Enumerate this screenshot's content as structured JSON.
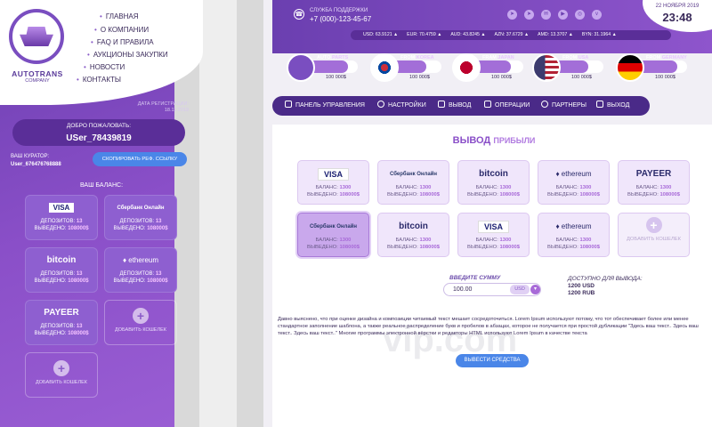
{
  "brand": {
    "name": "AUTOTRANS",
    "sub": "COMPANY"
  },
  "menu": [
    "ГЛАВНАЯ",
    "О КОМПАНИИ",
    "FAQ И ПРАВИЛА",
    "АУКЦИОНЫ ЗАКУПКИ",
    "НОВОСТИ",
    "КОНТАКТЫ"
  ],
  "reg": {
    "label": "ДАТА РЕГИСТРАЦИИ:",
    "date": "18.11.2019"
  },
  "welcome": {
    "label": "ДОБРО ПОЖАЛОВАТЬ:",
    "user": "USer_78439819"
  },
  "curator": {
    "label": "ВАШ КУРАТОР:",
    "name": "User_676476768888"
  },
  "copy_btn": "СКОПИРОВАТЬ РЕФ. ССЫЛКУ",
  "balance_title": "ВАШ БАЛАНС:",
  "left_cards": [
    {
      "logo": "VISA",
      "dep_l": "ДЕПОЗИТОВ:",
      "dep": "13",
      "out_l": "ВЫВЕДЕНО:",
      "out": "108000$"
    },
    {
      "logo": "Сбербанк Онлайн",
      "dep_l": "ДЕПОЗИТОВ:",
      "dep": "13",
      "out_l": "ВЫВЕДЕНО:",
      "out": "108000$"
    },
    {
      "logo": "bitcoin",
      "dep_l": "ДЕПОЗИТОВ:",
      "dep": "13",
      "out_l": "ВЫВЕДЕНО:",
      "out": "108000$"
    },
    {
      "logo": "ethereum",
      "dep_l": "ДЕПОЗИТОВ:",
      "dep": "13",
      "out_l": "ВЫВЕДЕНО:",
      "out": "108000$"
    },
    {
      "logo": "PAYEER",
      "dep_l": "ДЕПОЗИТОВ:",
      "dep": "13",
      "out_l": "ВЫВЕДЕНО:",
      "out": "108000$"
    }
  ],
  "add_wallet": "ДОБАВИТЬ КОШЕЛЕК",
  "support": {
    "label": "СЛУЖБА ПОДДЕРЖКИ",
    "phone": "+7 (000)-123-45-67"
  },
  "date": "22 НОЯБРЯ 2019",
  "time": "23:48",
  "rates": [
    "USD: 63.9121 ▲",
    "EUR: 70.4759 ▲",
    "AUD: 43.8245 ▲",
    "AZN: 37.6729 ▲",
    "AMD: 13.3707 ▲",
    "BYN: 31.1964 ▲"
  ],
  "progress": [
    {
      "k": "AUTO",
      "s": "PARTS",
      "amount": "100 000$",
      "color": "#7a4ec0",
      "pct": 0.8
    },
    {
      "k": "FROM",
      "s": "KOREA",
      "amount": "100 000$",
      "color": "#ffffff",
      "pct": 0.7
    },
    {
      "k": "FRAM",
      "s": "JAPAN",
      "amount": "100 000$",
      "color": "#ffffff",
      "pct": 0.75
    },
    {
      "k": "FROM",
      "s": "USA",
      "amount": "100 000$",
      "color": "#3c3b6e",
      "pct": 0.7
    },
    {
      "k": "FROM",
      "s": "GERMANY",
      "amount": "100 000$",
      "color": "#000000",
      "pct": 0.8
    }
  ],
  "nav": [
    "ПАНЕЛЬ УПРАВЛЕНИЯ",
    "НАСТРОЙКИ",
    "ВЫВОД",
    "ОПЕРАЦИИ",
    "ПАРТНЕРЫ",
    "ВЫХОД"
  ],
  "page_title": "ВЫВОД",
  "page_title2": "ПРИБЫЛИ",
  "wcards": [
    {
      "logo": "VISA",
      "bl": "БАЛАНС:",
      "b": "1300",
      "ol": "ВЫВЕДЕНО:",
      "o": "108000$"
    },
    {
      "logo": "Сбербанк Онлайн",
      "bl": "БАЛАНС:",
      "b": "1300",
      "ol": "ВЫВЕДЕНО:",
      "o": "108000$"
    },
    {
      "logo": "bitcoin",
      "bl": "БАЛАНС:",
      "b": "1300",
      "ol": "ВЫВЕДЕНО:",
      "o": "108000$"
    },
    {
      "logo": "ethereum",
      "bl": "БАЛАНС:",
      "b": "1300",
      "ol": "ВЫВЕДЕНО:",
      "o": "108000$"
    },
    {
      "logo": "PAYEER",
      "bl": "БАЛАНС:",
      "b": "1300",
      "ol": "ВЫВЕДЕНО:",
      "o": "108000$"
    },
    {
      "logo": "Сбербанк Онлайн",
      "bl": "БАЛАНС:",
      "b": "1300",
      "ol": "ВЫВЕДЕНО:",
      "o": "108000$"
    },
    {
      "logo": "bitcoin",
      "bl": "БАЛАНС:",
      "b": "1300",
      "ol": "ВЫВЕДЕНО:",
      "o": "108000$"
    },
    {
      "logo": "VISA",
      "bl": "БАЛАНС:",
      "b": "1300",
      "ol": "ВЫВЕДЕНО:",
      "o": "108000$"
    },
    {
      "logo": "ethereum",
      "bl": "БАЛАНС:",
      "b": "1300",
      "ol": "ВЫВЕДЕНО:",
      "o": "108000$"
    }
  ],
  "enter_label": "ВВЕДИТЕ СУММУ",
  "amount_value": "100.00",
  "currency": "USD",
  "avail": {
    "label": "ДОСТУПНО ДЛЯ ВЫВОДА:",
    "usd": "1200 USD",
    "rub": "1200 RUB"
  },
  "description": "Давно выяснено, что при оценке дизайна и композиции читаемый текст мешает сосредоточиться. Lorem Ipsum используют потому, что тот обеспечивает более или менее стандартное заполнение шаблона, а также реальное распределение букв и пробелов в абзацах, которое не получается при простой дубликации \"Здесь ваш текст.. Здесь ваш текст.. Здесь ваш текст..\" Многие программы электронной вёрстки и редакторы HTML используют Lorem Ipsum в качестве текста",
  "withdraw_btn": "ВЫВЕСТИ СРЕДСТВА",
  "watermark": "vip.com"
}
